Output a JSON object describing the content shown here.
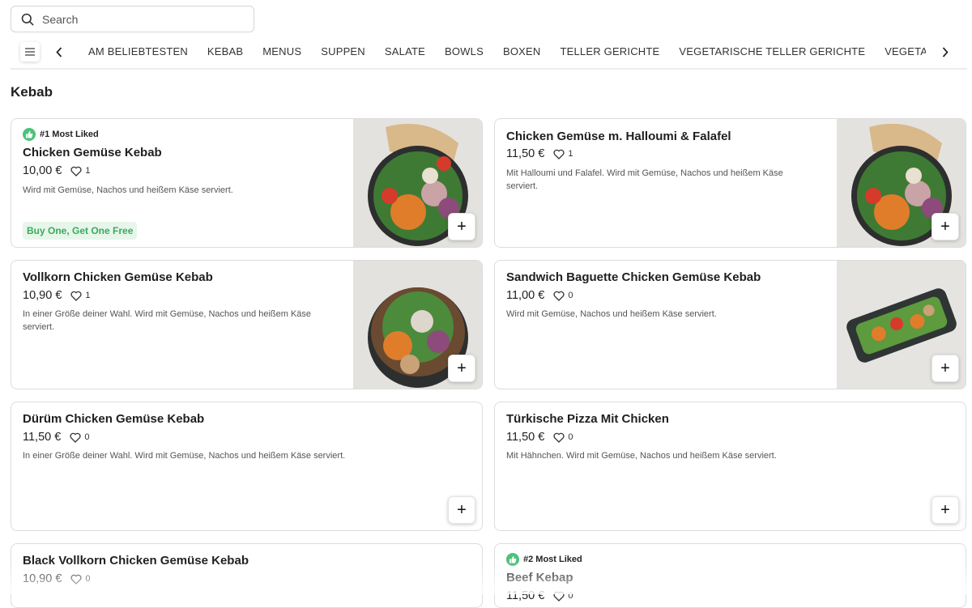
{
  "search": {
    "placeholder": "Search"
  },
  "categories": [
    "AM BELIEBTESTEN",
    "KEBAB",
    "MENUS",
    "SUPPEN",
    "SALATE",
    "BOWLS",
    "BOXEN",
    "TELLER GERICHTE",
    "VEGETARISCHE TELLER GERICHTE",
    "VEGETARISCHE GERICHTE"
  ],
  "section": {
    "title": "Kebab"
  },
  "products": [
    {
      "badge": "#1 Most Liked",
      "name": "Chicken Gemüse Kebab",
      "price": "10,00 €",
      "likes": "1",
      "description": "Wird mit Gemüse, Nachos und heißem Käse serviert.",
      "promo": "Buy One, Get One Free"
    },
    {
      "name": "Chicken Gemüse m. Halloumi & Falafel",
      "price": "11,50 €",
      "likes": "1",
      "description": "Mit Halloumi und Falafel. Wird mit Gemüse, Nachos und heißem Käse serviert."
    },
    {
      "name": "Vollkorn Chicken Gemüse Kebab",
      "price": "10,90 €",
      "likes": "1",
      "description": "In einer Größe deiner Wahl. Wird mit Gemüse, Nachos und heißem Käse serviert."
    },
    {
      "name": "Sandwich Baguette Chicken Gemüse Kebab",
      "price": "11,00 €",
      "likes": "0",
      "description": "Wird mit Gemüse, Nachos und heißem Käse serviert."
    },
    {
      "name": "Dürüm Chicken Gemüse Kebab",
      "price": "11,50 €",
      "likes": "0",
      "description": "In einer Größe deiner Wahl. Wird mit Gemüse, Nachos und heißem Käse serviert."
    },
    {
      "name": "Türkische Pizza Mit Chicken",
      "price": "11,50 €",
      "likes": "0",
      "description": "Mit Hähnchen. Wird mit Gemüse, Nachos und heißem Käse serviert."
    },
    {
      "name": "Black Vollkorn Chicken Gemüse Kebab",
      "price": "10,90 €",
      "likes": "0"
    },
    {
      "badge": "#2 Most Liked",
      "name": "Beef Kebap",
      "price": "11,50 €",
      "likes": "0"
    }
  ],
  "add_label": "+",
  "colors": {
    "accent_green": "#4cc27a",
    "promo_text": "#3aaa5c",
    "promo_bg": "#e6f6ea"
  }
}
